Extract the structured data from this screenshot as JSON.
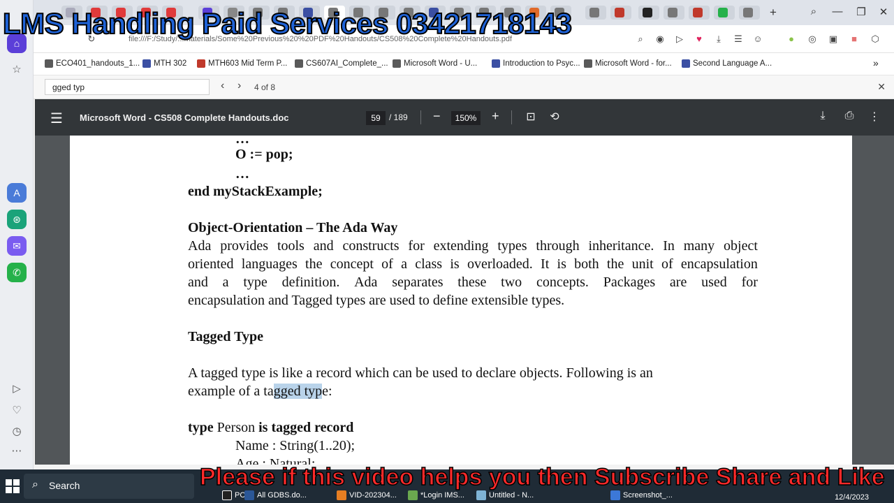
{
  "overlay": {
    "top_caption": "LMS Handling Paid Services 03421718143",
    "bottom_caption": "Please if this video helps you then Subscribe Share and Like"
  },
  "browser": {
    "url": "file:///F:/Study/...Materials/Some%20Previous%20%20PDF%20Handouts/CS508%20Complete%20Handouts.pdf",
    "bookmarks": [
      {
        "label": "ECO401_handouts_1...",
        "color": "#5a5a5a"
      },
      {
        "label": "MTH 302",
        "color": "#3b4fa3"
      },
      {
        "label": "MTH603 Mid Term P...",
        "color": "#c0392b"
      },
      {
        "label": "CS607AI_Complete_...",
        "color": "#5a5a5a"
      },
      {
        "label": "Microsoft Word - U...",
        "color": "#5a5a5a"
      },
      {
        "label": "Introduction to Psyc...",
        "color": "#3b4fa3"
      },
      {
        "label": "Microsoft Word - for...",
        "color": "#5a5a5a"
      },
      {
        "label": "Second Language A...",
        "color": "#3b4fa3"
      }
    ],
    "more_bookmarks": "»",
    "find": {
      "query": "gged typ",
      "count": "4 of 8",
      "prev": "‹",
      "next": "›",
      "close": "✕"
    }
  },
  "pdf": {
    "menu_icon": "☰",
    "title": "Microsoft Word - CS508 Complete Handouts.doc",
    "page_current": "59",
    "page_total": "/ 189",
    "zoom_out": "−",
    "zoom": "150%",
    "zoom_in": "+",
    "icons": {
      "fit": "⊡",
      "rotate": "⟲",
      "download": "⤓",
      "print": "⎙",
      "more": "⋮"
    }
  },
  "document": {
    "ellipsis1": "…",
    "pop_line": "O := pop;",
    "ellipsis2": "…",
    "end_line": "end myStackExample;",
    "heading1": "Object-Orientation – The Ada Way",
    "para1_lines": [
      [
        "Ada",
        "provides",
        "tools",
        "and",
        "constructs",
        "for",
        "extending",
        "types",
        "through",
        "inheritance.",
        "In",
        "many",
        "object"
      ],
      [
        "oriented",
        "languages",
        "the",
        "concept",
        "of",
        "a",
        "class",
        "is",
        "overloaded.",
        "It",
        "is",
        "both",
        "the",
        "unit",
        "of",
        "encapsulation"
      ],
      [
        "and",
        "a",
        "type",
        "definition.",
        "Ada",
        "separates",
        "these",
        "two",
        "concepts.",
        "Packages",
        "are",
        "used",
        "for"
      ]
    ],
    "para1_last": "encapsulation and Tagged types are used to define extensible types.",
    "heading2": "Tagged Type",
    "para2_line1": "A tagged type is like a record which can be used to declare objects. Following is an",
    "para2_line2_pre": "example of a ta",
    "para2_line2_hl": "gged typ",
    "para2_line2_post": "e:",
    "code_type": "type",
    "code_person": " Person ",
    "code_is_tagged": "is tagged record",
    "code_name": "Name : String(1..20);",
    "code_age": "Age : Natural;"
  },
  "taskbar": {
    "search_label": "Search",
    "items": [
      {
        "label": "PC",
        "color": "#222"
      },
      {
        "label": "All GDBS.do...",
        "color": "#2b5797"
      },
      {
        "label": "VID-202304...",
        "color": "#e67e22"
      },
      {
        "label": "*Login IMS...",
        "color": "#6aa84f"
      },
      {
        "label": "Untitled - N...",
        "color": "#7fb3d5"
      },
      {
        "label": "Screenshot_...",
        "color": "#3c78d8"
      }
    ],
    "date": "12/4/2023"
  }
}
